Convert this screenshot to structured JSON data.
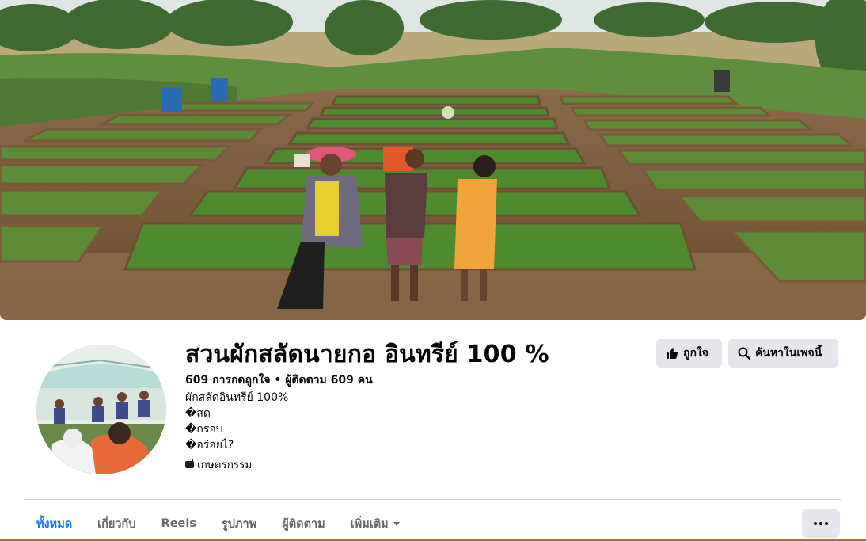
{
  "page": {
    "name": "สวนผักสลัดนายกอ อินทรีย์ 100 %",
    "stats": "609 การกดถูกใจ • ผู้ติดตาม 609 คน",
    "bio_lines": [
      "ผักสลัดอินทรีย์ 100%",
      "�สด",
      "�กรอบ",
      "�อร่อยไ?"
    ],
    "category": "เกษตรกรรม"
  },
  "actions": {
    "like_label": "ถูกใจ",
    "search_label": "ค้นหาในเพจนี้"
  },
  "tabs": [
    {
      "label": "ทั้งหมด",
      "active": true
    },
    {
      "label": "เกี่ยวกับ"
    },
    {
      "label": "Reels"
    },
    {
      "label": "รูปภาพ"
    },
    {
      "label": "ผู้ติดตาม"
    },
    {
      "label": "เพิ่มเติม"
    }
  ],
  "icons": {
    "like": "thumbs-up-icon",
    "search": "search-icon",
    "category": "briefcase-icon",
    "more": "more-options-icon"
  },
  "colors": {
    "accent": "#1877f2",
    "button_bg": "#e4e6eb",
    "muted_text": "#65676b"
  }
}
